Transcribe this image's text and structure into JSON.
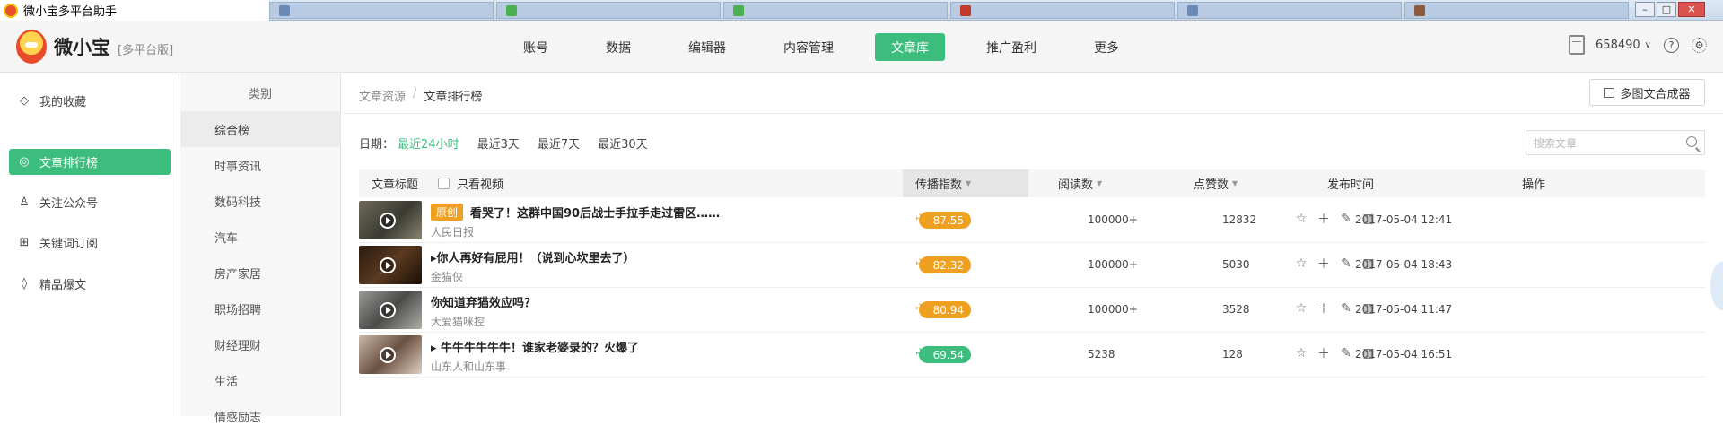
{
  "window": {
    "title": "微小宝多平台助手"
  },
  "header": {
    "logo_name": "微小宝",
    "logo_version": "[多平台版]",
    "nav": [
      "账号",
      "数据",
      "编辑器",
      "内容管理",
      "文章库",
      "推广盈利",
      "更多"
    ],
    "active_nav": "文章库",
    "account_id": "658490"
  },
  "sidebar": {
    "items": [
      "我的收藏",
      "文章排行榜",
      "关注公众号",
      "关键词订阅",
      "精品爆文"
    ]
  },
  "categories": {
    "header": "类别",
    "items": [
      "综合榜",
      "时事资讯",
      "数码科技",
      "汽车",
      "房产家居",
      "职场招聘",
      "财经理财",
      "生活",
      "情感励志"
    ]
  },
  "breadcrumb": {
    "root": "文章资源",
    "sep": "/",
    "current": "文章排行榜"
  },
  "merge_button": "多图文合成器",
  "date_filter": {
    "label": "日期：",
    "options": [
      "最近24小时",
      "最近3天",
      "最近7天",
      "最近30天"
    ]
  },
  "search": {
    "placeholder": "搜索文章"
  },
  "table": {
    "headers": {
      "title": "文章标题",
      "video_only": "只看视频",
      "score": "传播指数",
      "reads": "阅读数",
      "likes": "点赞数",
      "date": "发布时间",
      "ops": "操作"
    },
    "rows": [
      {
        "badge": "原创",
        "title": "看哭了！这群中国90后战士手拉手走过雷区……",
        "account": "人民日报",
        "score": "87.55",
        "reads": "100000+",
        "likes": "12832",
        "date": "2017-05-04 12:41"
      },
      {
        "badge": "",
        "title": "▸你人再好有屁用！（说到心坎里去了）",
        "account": "金猫侠",
        "score": "82.32",
        "reads": "100000+",
        "likes": "5030",
        "date": "2017-05-04 18:43"
      },
      {
        "badge": "",
        "title": "你知道弃猫效应吗？",
        "account": "大爱猫咪控",
        "score": "80.94",
        "reads": "100000+",
        "likes": "3528",
        "date": "2017-05-04 11:47"
      },
      {
        "badge": "",
        "title": "▸ 牛牛牛牛牛牛！谁家老婆录的？火爆了",
        "account": "山东人和山东事",
        "score": "69.54",
        "reads": "5238",
        "likes": "128",
        "date": "2017-05-04 16:51"
      }
    ]
  },
  "colors": {
    "accent": "#3dbd7d",
    "score_orange": "#f0a020",
    "score_green": "#3dbd7d"
  }
}
